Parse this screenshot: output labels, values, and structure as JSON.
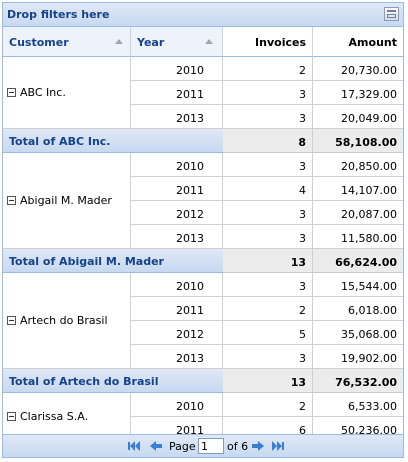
{
  "filter_bar": {
    "label": "Drop filters here",
    "icon": "filter-list-icon"
  },
  "columns": [
    {
      "label": "Customer",
      "sortable": true
    },
    {
      "label": "Year",
      "sortable": true
    },
    {
      "label": "Invoices",
      "sortable": false
    },
    {
      "label": "Amount",
      "sortable": false
    }
  ],
  "groups": [
    {
      "customer": "ABC Inc.",
      "rows": [
        {
          "year": "2010",
          "invoices": "2",
          "amount": "20,730.00"
        },
        {
          "year": "2011",
          "invoices": "3",
          "amount": "17,329.00"
        },
        {
          "year": "2013",
          "invoices": "3",
          "amount": "20,049.00"
        }
      ],
      "total": {
        "label": "Total of ABC Inc.",
        "invoices": "8",
        "amount": "58,108.00"
      }
    },
    {
      "customer": "Abigail M. Mader",
      "rows": [
        {
          "year": "2010",
          "invoices": "3",
          "amount": "20,850.00"
        },
        {
          "year": "2011",
          "invoices": "4",
          "amount": "14,107.00"
        },
        {
          "year": "2012",
          "invoices": "3",
          "amount": "20,087.00"
        },
        {
          "year": "2013",
          "invoices": "3",
          "amount": "11,580.00"
        }
      ],
      "total": {
        "label": "Total of Abigail M. Mader",
        "invoices": "13",
        "amount": "66,624.00"
      }
    },
    {
      "customer": "Artech do Brasil",
      "rows": [
        {
          "year": "2010",
          "invoices": "3",
          "amount": "15,544.00"
        },
        {
          "year": "2011",
          "invoices": "2",
          "amount": "6,018.00"
        },
        {
          "year": "2012",
          "invoices": "5",
          "amount": "35,068.00"
        },
        {
          "year": "2013",
          "invoices": "3",
          "amount": "19,902.00"
        }
      ],
      "total": {
        "label": "Total of Artech do Brasil",
        "invoices": "13",
        "amount": "76,532.00"
      }
    },
    {
      "customer": "Clarissa S.A.",
      "rows": [
        {
          "year": "2010",
          "invoices": "2",
          "amount": "6,533.00"
        },
        {
          "year": "2011",
          "invoices": "6",
          "amount": "50,236.00"
        }
      ]
    }
  ],
  "pager": {
    "page_label": "Page",
    "current_page": "1",
    "of_label": "of 6"
  },
  "colors": {
    "header_text": "#15428b",
    "border": "#99bbe8",
    "total_bg": "#ececec"
  }
}
